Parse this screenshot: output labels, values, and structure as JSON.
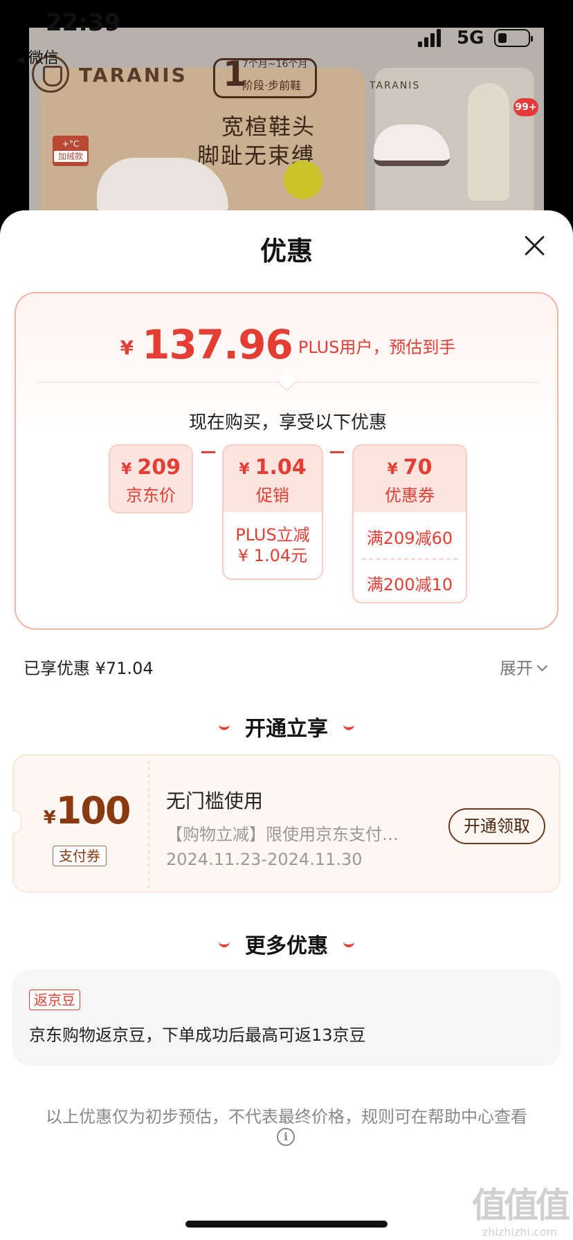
{
  "status_bar": {
    "time": "22:39",
    "network": "5G",
    "back_app": "微信"
  },
  "background": {
    "brand": "TARANIS",
    "stage_number": "1",
    "stage_range": "7个月~16个月",
    "stage_label": "阶段·步前鞋",
    "slogan_line1": "宽楦鞋头",
    "slogan_line2": "脚趾无束缚",
    "warm_tag_line1": "+°C",
    "warm_tag_line2": "加绒款",
    "brand2": "TARANIS",
    "badge": "99+"
  },
  "sheet": {
    "title": "优惠",
    "price_card": {
      "currency": "¥",
      "final_price": "137.96",
      "final_note": "PLUS用户，预估到手",
      "subtitle": "现在购买，享受以下优惠",
      "items": [
        {
          "value": "209",
          "label": "京东价",
          "details": []
        },
        {
          "value": "1.04",
          "label": "促销",
          "details": [
            "PLUS立减",
            "¥ 1.04元"
          ]
        },
        {
          "value": "70",
          "label": "优惠券",
          "details": [
            "满209减60",
            "满200减10"
          ]
        }
      ]
    },
    "saved": {
      "label": "已享优惠 ¥71.04",
      "expand": "展开"
    },
    "open_section": {
      "title": "开通立享",
      "coupon": {
        "currency": "¥",
        "amount": "100",
        "type": "支付券",
        "title": "无门槛使用",
        "description": "【购物立减】限使用京东支付…",
        "date_range": "2024.11.23-2024.11.30",
        "button": "开通领取"
      }
    },
    "more_section": {
      "title": "更多优惠",
      "tag": "返京豆",
      "text": "京东购物返京豆，下单成功后最高可返13京豆"
    },
    "disclaimer": "以上优惠仅为初步预估，不代表最终价格，规则可在帮助中心查看"
  },
  "watermark": {
    "line1": "值值值",
    "line2": "zhizhizhi.com"
  },
  "colors": {
    "accent_red": "#e43d33",
    "coupon_brown": "#8a3a12",
    "card_border": "#f2b3a7"
  },
  "icons": [
    "close-icon",
    "chevron-down-icon",
    "info-icon",
    "signal-icon",
    "battery-icon"
  ]
}
